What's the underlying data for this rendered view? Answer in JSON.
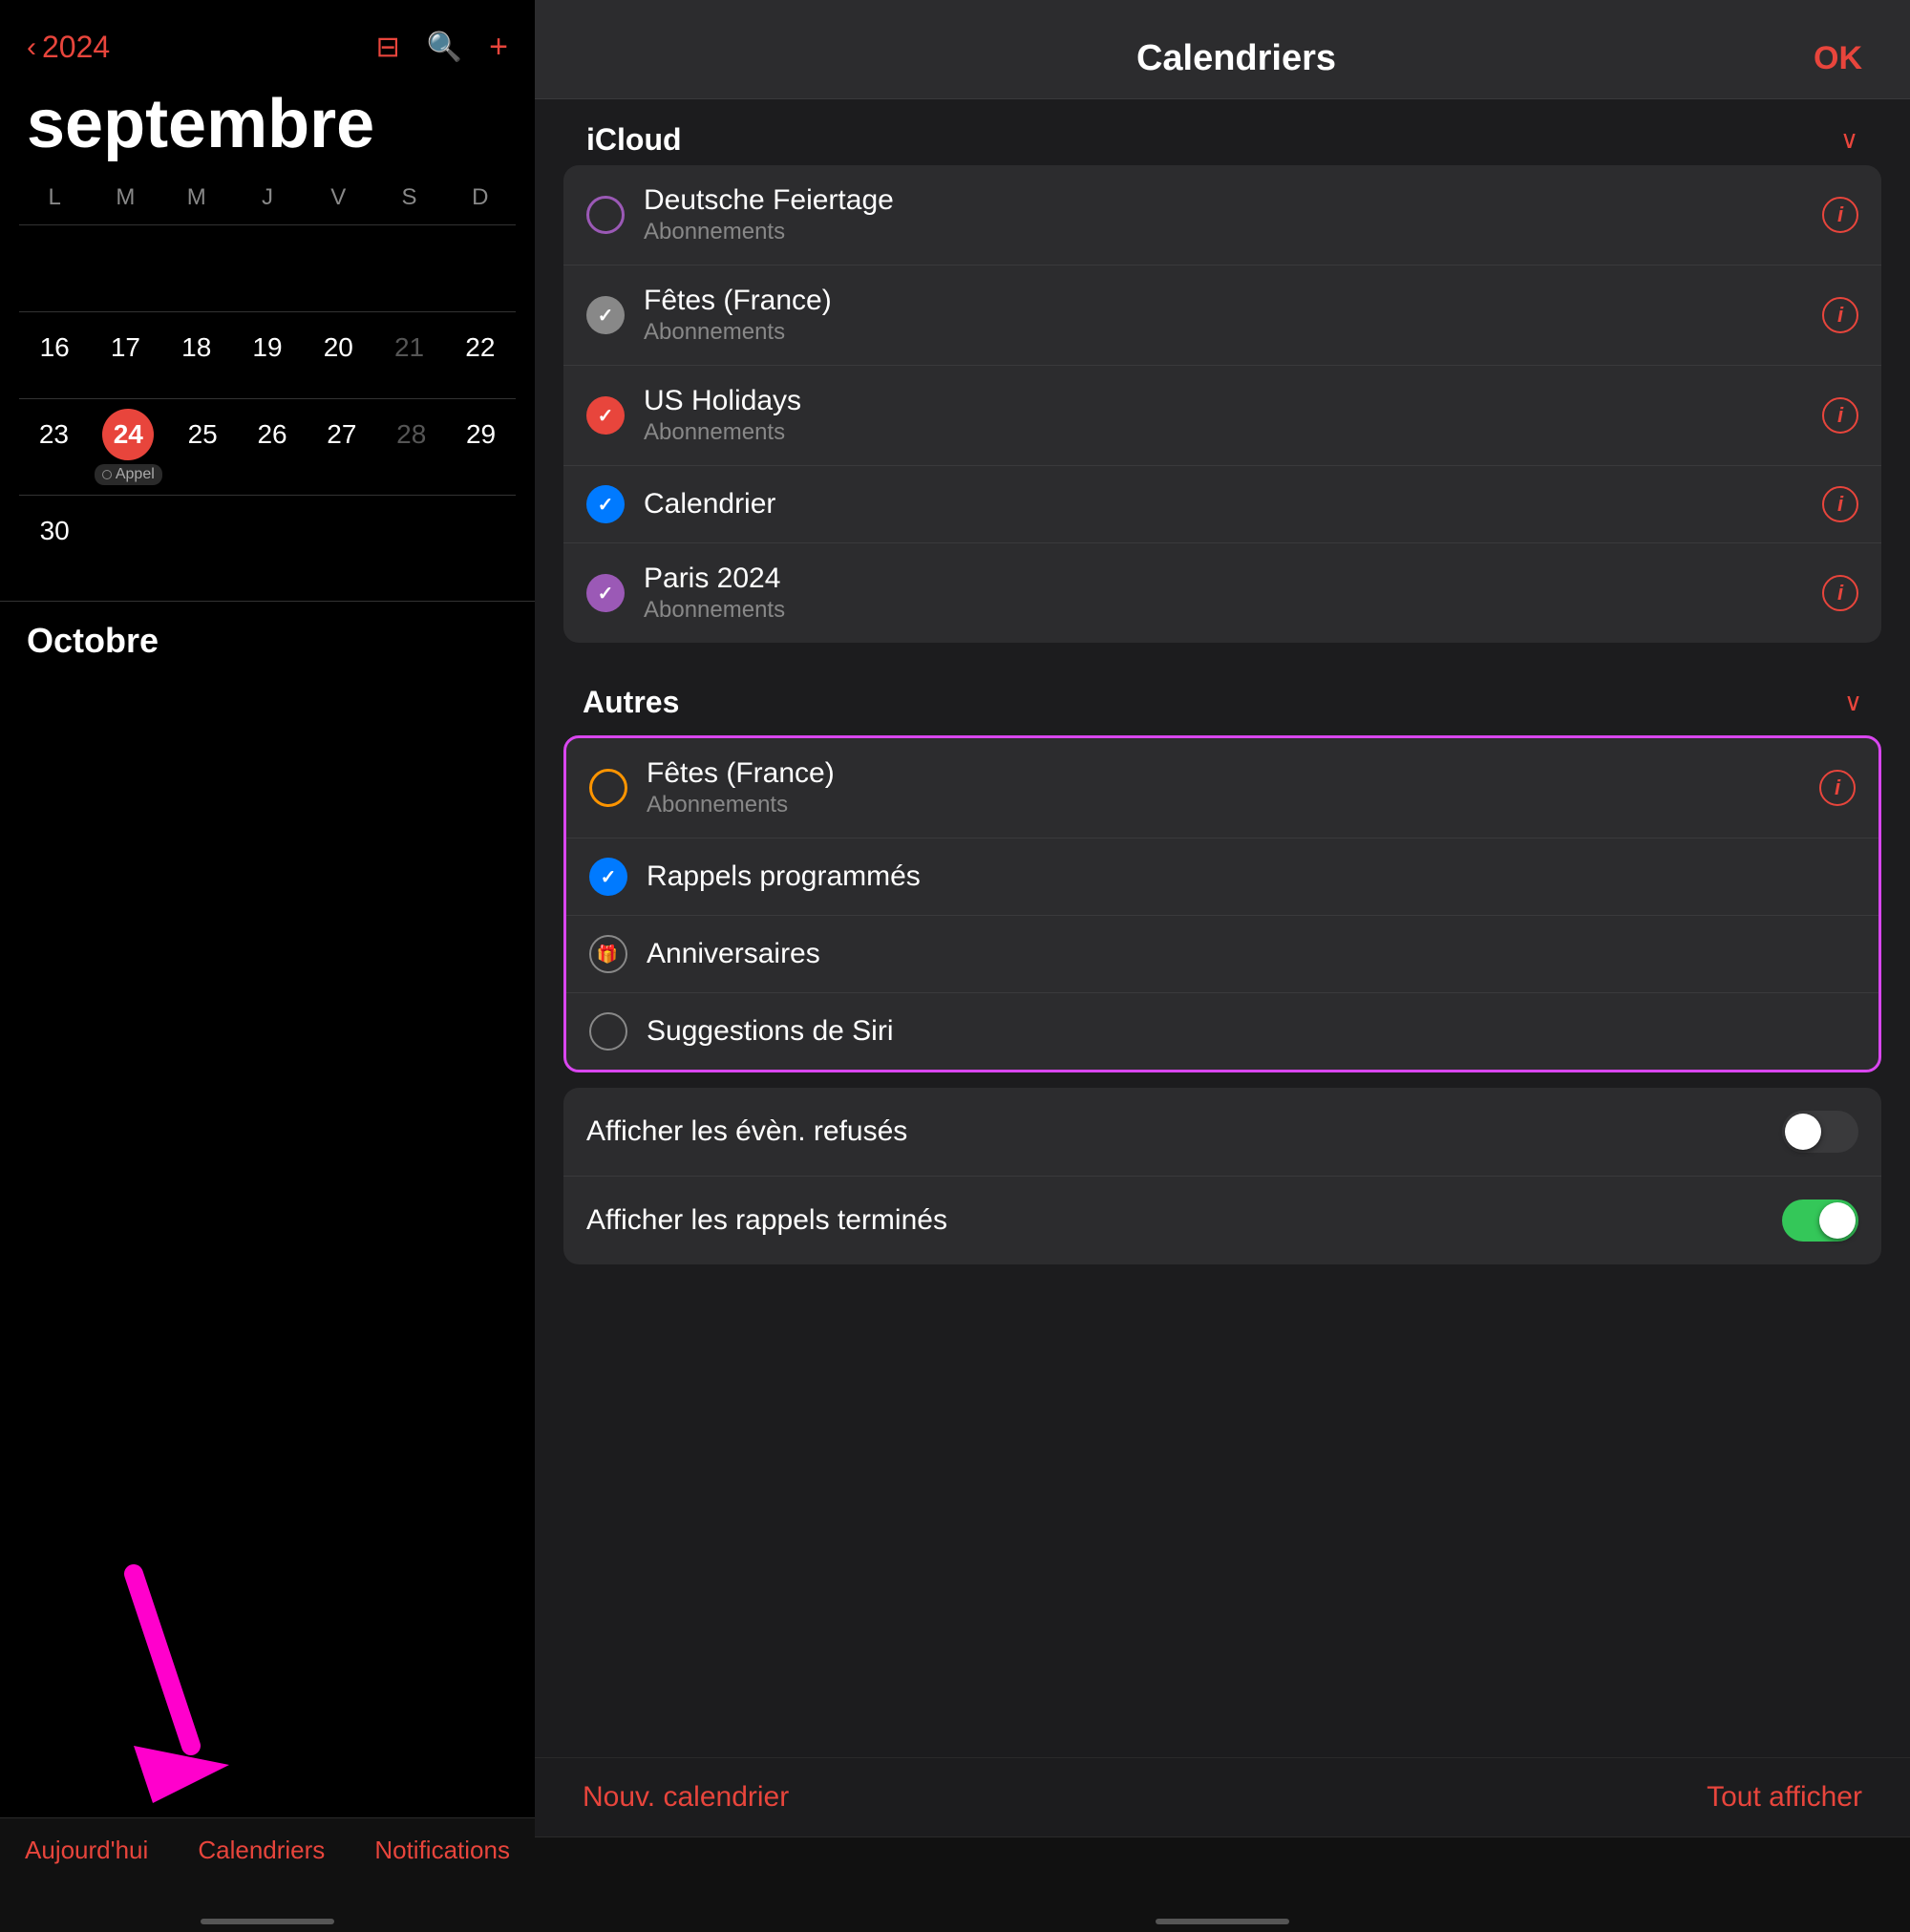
{
  "left": {
    "back_year": "2024",
    "month": "septembre",
    "day_headers": [
      "L",
      "M",
      "M",
      "J",
      "V",
      "S",
      "D"
    ],
    "weeks": [
      [
        {
          "num": "",
          "style": ""
        },
        {
          "num": "",
          "style": ""
        },
        {
          "num": "",
          "style": ""
        },
        {
          "num": "",
          "style": ""
        },
        {
          "num": "",
          "style": ""
        },
        {
          "num": "",
          "style": ""
        },
        {
          "num": "",
          "style": ""
        }
      ],
      [
        {
          "num": "16",
          "style": ""
        },
        {
          "num": "17",
          "style": ""
        },
        {
          "num": "18",
          "style": ""
        },
        {
          "num": "19",
          "style": ""
        },
        {
          "num": "20",
          "style": ""
        },
        {
          "num": "21",
          "style": "other-month"
        },
        {
          "num": "22",
          "style": ""
        }
      ],
      [
        {
          "num": "23",
          "style": ""
        },
        {
          "num": "24",
          "style": "today",
          "event": "Appel"
        },
        {
          "num": "25",
          "style": ""
        },
        {
          "num": "26",
          "style": ""
        },
        {
          "num": "27",
          "style": ""
        },
        {
          "num": "28",
          "style": "other-month"
        },
        {
          "num": "29",
          "style": ""
        }
      ],
      [
        {
          "num": "30",
          "style": ""
        },
        {
          "num": "",
          "style": ""
        },
        {
          "num": "",
          "style": ""
        },
        {
          "num": "",
          "style": ""
        },
        {
          "num": "",
          "style": ""
        },
        {
          "num": "",
          "style": ""
        },
        {
          "num": "",
          "style": ""
        }
      ]
    ],
    "next_month": "Octobre",
    "tabs": [
      "Aujourd'hui",
      "Calendriers",
      "Notifications"
    ]
  },
  "right": {
    "title": "Calendriers",
    "ok_label": "OK",
    "icloud_label": "iCloud",
    "icloud_items": [
      {
        "name": "Deutsche Feiertage",
        "sub": "Abonnements",
        "circle": "purple-outline",
        "checked": false
      },
      {
        "name": "Fêtes (France)",
        "sub": "Abonnements",
        "circle": "gray-check",
        "checked": true
      },
      {
        "name": "US Holidays",
        "sub": "Abonnements",
        "circle": "red-check",
        "checked": true
      },
      {
        "name": "Calendrier",
        "sub": "",
        "circle": "blue-check",
        "checked": true
      },
      {
        "name": "Paris 2024",
        "sub": "Abonnements",
        "circle": "purple-check",
        "checked": true
      }
    ],
    "autres_label": "Autres",
    "autres_items": [
      {
        "name": "Fêtes (France)",
        "sub": "Abonnements",
        "circle": "orange-outline",
        "checked": false
      },
      {
        "name": "Rappels programmés",
        "sub": "",
        "circle": "blue-check-solid",
        "checked": true
      },
      {
        "name": "Anniversaires",
        "sub": "",
        "circle": "gray-outline",
        "checked": false,
        "special_icon": "🎁"
      },
      {
        "name": "Suggestions de Siri",
        "sub": "",
        "circle": "gray-outline",
        "checked": false
      }
    ],
    "toggles": [
      {
        "label": "Afficher les évèn. refusés",
        "state": "off"
      },
      {
        "label": "Afficher les rappels terminés",
        "state": "on"
      }
    ],
    "bottom_actions": [
      "Nouv. calendrier",
      "Tout afficher"
    ]
  }
}
